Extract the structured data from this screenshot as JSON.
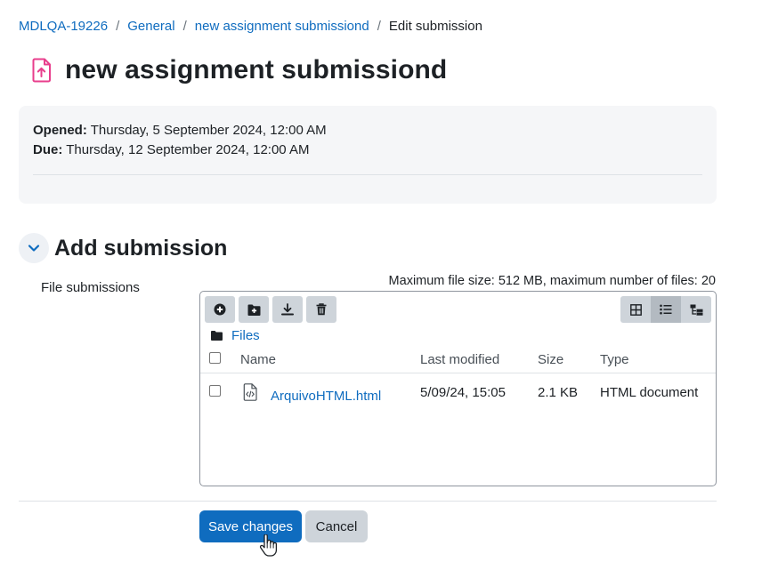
{
  "breadcrumb": {
    "items": [
      "MDLQA-19226",
      "General",
      "new assignment submissiond"
    ],
    "separator": "/",
    "current": "Edit submission"
  },
  "page": {
    "title": "new assignment submissiond",
    "icon": "assignment-upload-icon"
  },
  "dates": {
    "opened_label": "Opened:",
    "opened_value": "Thursday, 5 September 2024, 12:00 AM",
    "due_label": "Due:",
    "due_value": "Thursday, 12 September 2024, 12:00 AM"
  },
  "section": {
    "title": "Add submission",
    "field_label": "File submissions",
    "max_info": "Maximum file size: 512 MB, maximum number of files: 20"
  },
  "filepicker": {
    "toolbar": [
      "add-file-icon",
      "create-folder-icon",
      "download-icon",
      "delete-icon"
    ],
    "views": [
      "grid-view-icon",
      "list-view-icon",
      "tree-view-icon"
    ],
    "path_label": "Files",
    "columns": [
      "Name",
      "Last modified",
      "Size",
      "Type"
    ],
    "files": [
      {
        "name": "ArquivoHTML.html",
        "last_modified": "5/09/24, 15:05",
        "size": "2.1 KB",
        "type": "HTML document",
        "icon": "html-file-icon"
      }
    ]
  },
  "buttons": {
    "save": "Save changes",
    "cancel": "Cancel"
  },
  "colors": {
    "link": "#0f6cbf",
    "primary": "#0f6cbf",
    "secondary": "#ced4da",
    "assignment_icon": "#e83e8c"
  }
}
